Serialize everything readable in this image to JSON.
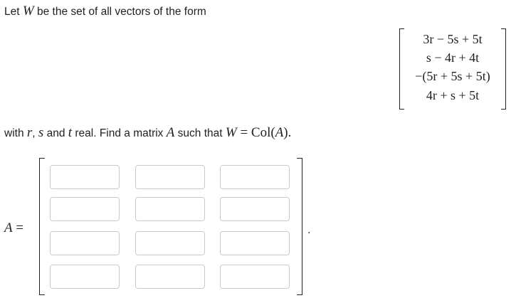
{
  "question": {
    "line1_prefix": "Let ",
    "line1_var": "W",
    "line1_suffix": " be the set of all vectors of the form",
    "line2_prefix": "with ",
    "line2_r": "r",
    "line2_comma1": ", ",
    "line2_s": "s",
    "line2_and": " and ",
    "line2_t": "t",
    "line2_mid": " real. Find a matrix ",
    "line2_A": "A",
    "line2_such": " such that ",
    "line2_W": "W",
    "line2_eq": " = ",
    "line2_col": "Col(",
    "line2_A2": "A",
    "line2_close": ").",
    "vector_rows": [
      "3r − 5s + 5t",
      "s − 4r + 4t",
      "−(5r + 5s + 5t)",
      "4r + s + 5t"
    ]
  },
  "answer": {
    "label_var": "A",
    "label_eq": " =",
    "period": ".",
    "rows": 4,
    "cols": 3,
    "cells": [
      [
        "",
        "",
        ""
      ],
      [
        "",
        "",
        ""
      ],
      [
        "",
        "",
        ""
      ],
      [
        "",
        "",
        ""
      ]
    ]
  }
}
